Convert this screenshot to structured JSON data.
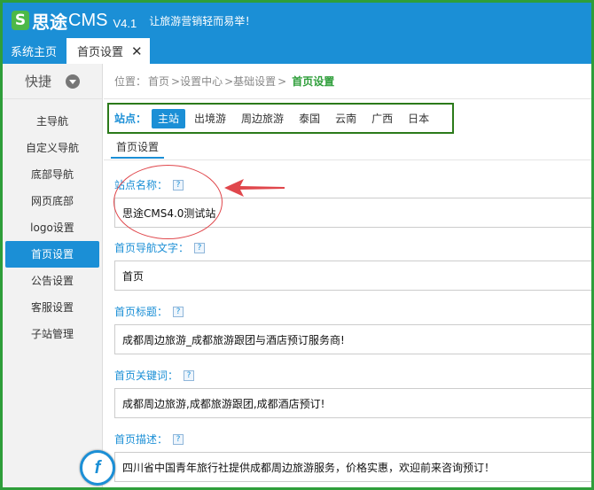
{
  "header": {
    "logo_s": "S",
    "logo_name": "思途",
    "logo_cms": "CMS",
    "version": "V4.1",
    "slogan": "让旅游营销轻而易举！"
  },
  "tabs": {
    "home": "系统主页",
    "active": "首页设置",
    "close_icon": "✕"
  },
  "sidebar": {
    "quick_label": "快捷",
    "items": [
      {
        "label": "主导航"
      },
      {
        "label": "自定义导航"
      },
      {
        "label": "底部导航"
      },
      {
        "label": "网页底部"
      },
      {
        "label": "logo设置"
      },
      {
        "label": "首页设置"
      },
      {
        "label": "公告设置"
      },
      {
        "label": "客服设置"
      },
      {
        "label": "子站管理"
      }
    ],
    "active_index": 5
  },
  "breadcrumb": {
    "prefix": "位置：",
    "items": [
      "首页",
      ">设置中心",
      ">基础设置",
      ">"
    ],
    "current": "首页设置"
  },
  "sites": {
    "label": "站点：",
    "items": [
      "主站",
      "出境游",
      "周边旅游",
      "泰国",
      "云南",
      "广西",
      "日本"
    ],
    "active_index": 0
  },
  "subtab": "首页设置",
  "fields": [
    {
      "label": "站点名称：",
      "value": "思途CMS4.0测试站"
    },
    {
      "label": "首页导航文字：",
      "value": "首页"
    },
    {
      "label": "首页标题：",
      "value": "成都周边旅游_成都旅游跟团与酒店预订服务商!"
    },
    {
      "label": "首页关键词：",
      "value": "成都周边旅游,成都旅游跟团,成都酒店预订!"
    },
    {
      "label": "首页描述：",
      "value": "四川省中国青年旅行社提供成都周边旅游服务，价格实惠，欢迎前来咨询预订！"
    }
  ],
  "help_glyph": "?",
  "float_logo_glyph": "f",
  "colors": {
    "header_blue": "#1b8fd6",
    "frame_green": "#2e9e3a",
    "annotation_red": "#e0474c"
  },
  "icons": {
    "quick_toggle": "chevron-down-circle-icon",
    "annotation": "red-arrow-icon"
  }
}
